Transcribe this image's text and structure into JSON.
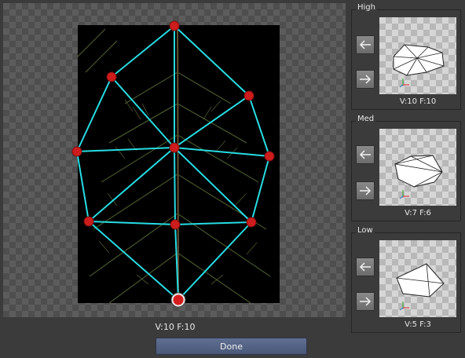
{
  "editor": {
    "stats": "V:10  F:10",
    "done_label": "Done"
  },
  "lods": [
    {
      "label": "High",
      "stats": "V:10  F:10",
      "prev_icon": "arrow-left-icon",
      "next_icon": "arrow-right-icon"
    },
    {
      "label": "Med",
      "stats": "V:7  F:6",
      "prev_icon": "arrow-left-icon",
      "next_icon": "arrow-right-icon"
    },
    {
      "label": "Low",
      "stats": "V:5  F:3",
      "prev_icon": "arrow-left-icon",
      "next_icon": "arrow-right-icon"
    }
  ],
  "colors": {
    "edge": "#27dde3",
    "vertex": "#cc1c1c",
    "accent_button": "#56648a"
  }
}
